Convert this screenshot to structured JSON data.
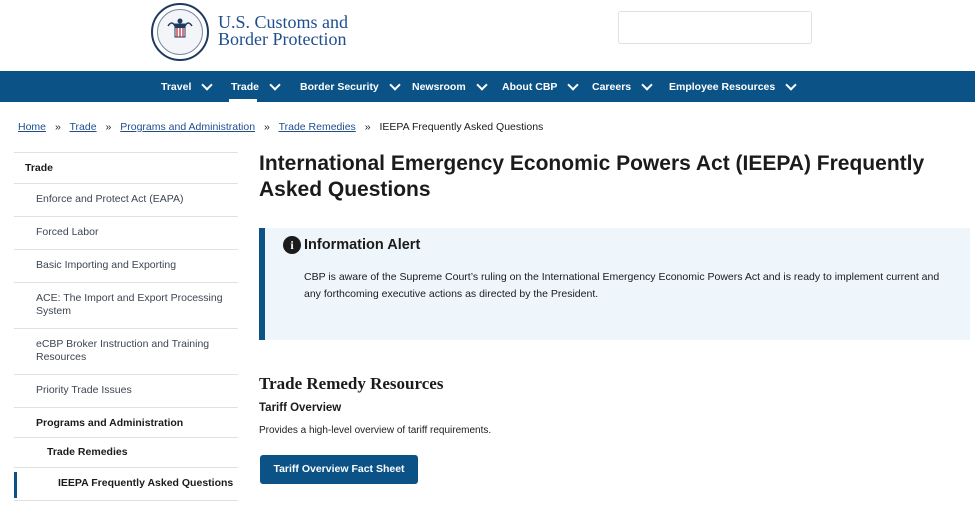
{
  "header": {
    "brand_line1": "U.S. Customs and",
    "brand_line2": "Border Protection",
    "search_placeholder": ""
  },
  "nav": {
    "items": [
      {
        "label": "Travel"
      },
      {
        "label": "Trade",
        "active": true
      },
      {
        "label": "Border Security"
      },
      {
        "label": "Newsroom"
      },
      {
        "label": "About CBP"
      },
      {
        "label": "Careers"
      },
      {
        "label": "Employee Resources"
      }
    ]
  },
  "breadcrumb": {
    "items": [
      "Home",
      "Trade",
      "Programs and Administration",
      "Trade Remedies"
    ],
    "current": "IEEPA Frequently Asked Questions",
    "separator": "»"
  },
  "sidebar": {
    "items": [
      {
        "label": "Trade"
      },
      {
        "label": "Enforce and Protect Act (EAPA)"
      },
      {
        "label": "Forced Labor"
      },
      {
        "label": "Basic Importing and Exporting"
      },
      {
        "label": "ACE: The Import and Export Processing System"
      },
      {
        "label": "eCBP Broker Instruction and Training Resources"
      },
      {
        "label": "Priority Trade Issues"
      },
      {
        "label": "Programs and Administration"
      },
      {
        "label": "Trade Remedies"
      },
      {
        "label": "IEEPA Frequently Asked Questions"
      }
    ]
  },
  "main": {
    "title": "International Emergency Economic Powers Act (IEEPA) Frequently Asked Questions",
    "alert": {
      "icon": "info-icon",
      "heading": "Information Alert",
      "body": "CBP is aware of the Supreme Court’s ruling on the International Emergency Economic Powers Act and is ready to implement current and any forthcoming executive actions as directed by the President."
    },
    "section_title": "Trade Remedy Resources",
    "tariff_title": "Tariff Overview",
    "tariff_desc": "Provides a high-level overview of tariff requirements.",
    "cta_label": "Tariff Overview Fact Sheet"
  },
  "colors": {
    "nav_bg": "#0b5286",
    "brand_blue": "#1f4e8c",
    "alert_bg": "#eef6fb"
  }
}
